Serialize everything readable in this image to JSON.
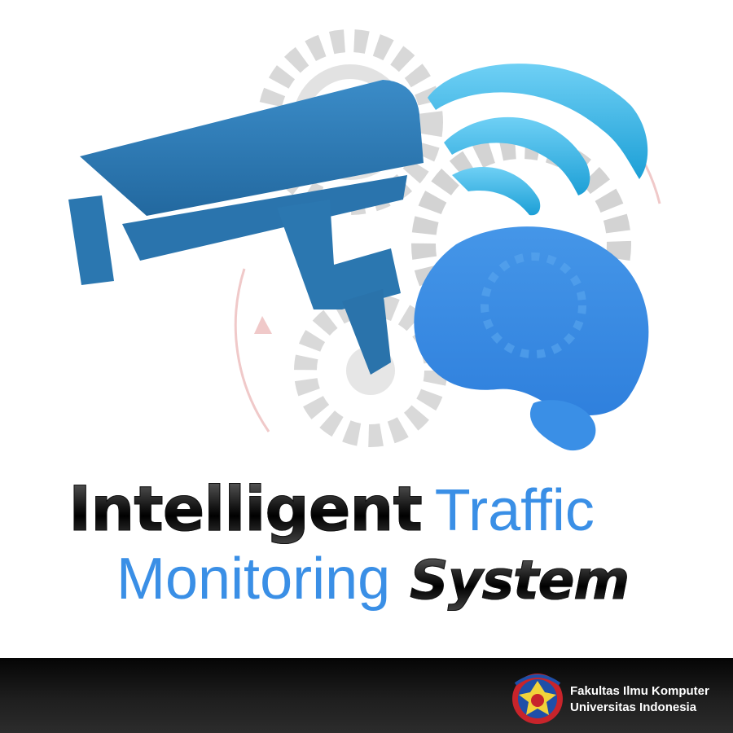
{
  "colors": {
    "brand_blue": "#3a8fe6",
    "camera_blue": "#2b79b3",
    "signal_cyan": "#2fb6e6",
    "gear_gray": "#d6d6d6",
    "title_dark": "#111111",
    "footer_bg": "#1c1c1c",
    "footer_text": "#ffffff"
  },
  "icons": {
    "camera": "cctv-camera-icon",
    "signal": "wireless-signal-icon",
    "brain": "brain-icon",
    "gears": "gear-icon",
    "seal": "university-seal-icon"
  },
  "title": {
    "word1": "Intelligent",
    "word2": "Traffic",
    "word3": "Monitoring",
    "word4": "System"
  },
  "footer": {
    "line1": "Fakultas Ilmu Komputer",
    "line2": "Universitas Indonesia"
  }
}
